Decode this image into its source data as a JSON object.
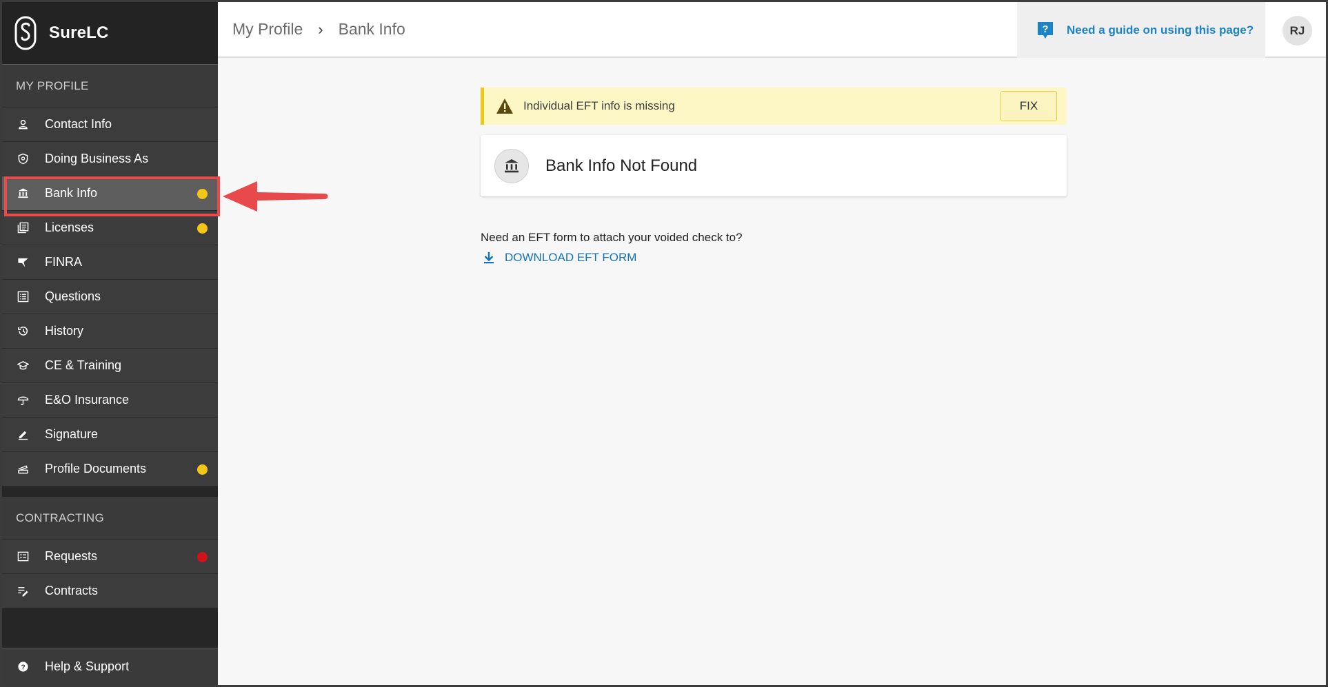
{
  "brand": {
    "name": "SureLC"
  },
  "breadcrumb": {
    "parent": "My Profile",
    "separator": "›",
    "current": "Bank Info"
  },
  "header": {
    "guide_label": "Need a guide on using this page?",
    "avatar_initials": "RJ"
  },
  "sidebar": {
    "profile_header": "MY PROFILE",
    "profile_items": [
      {
        "label": "Contact Info",
        "icon": "person-icon"
      },
      {
        "label": "Doing Business As",
        "icon": "badge-icon"
      },
      {
        "label": "Bank Info",
        "icon": "bank-icon",
        "active": true,
        "status": "warning"
      },
      {
        "label": "Licenses",
        "icon": "licenses-icon",
        "status": "warning"
      },
      {
        "label": "FINRA",
        "icon": "finra-icon"
      },
      {
        "label": "Questions",
        "icon": "list-icon"
      },
      {
        "label": "History",
        "icon": "history-icon"
      },
      {
        "label": "CE & Training",
        "icon": "graduation-cap-icon"
      },
      {
        "label": "E&O Insurance",
        "icon": "umbrella-icon"
      },
      {
        "label": "Signature",
        "icon": "pen-icon"
      },
      {
        "label": "Profile Documents",
        "icon": "scanner-icon",
        "status": "warning"
      }
    ],
    "contracting_header": "CONTRACTING",
    "contracting_items": [
      {
        "label": "Requests",
        "icon": "requests-icon",
        "status": "error"
      },
      {
        "label": "Contracts",
        "icon": "contract-edit-icon"
      }
    ],
    "help_label": "Help & Support"
  },
  "alert": {
    "message": "Individual EFT info is missing",
    "fix_label": "FIX"
  },
  "card": {
    "title": "Bank Info Not Found"
  },
  "eft": {
    "question": "Need an EFT form to attach your voided check to?",
    "download_label": "DOWNLOAD EFT FORM"
  },
  "colors": {
    "warning_dot": "#f5c518",
    "error_dot": "#d0121b",
    "link": "#1673b8",
    "annotation_red": "#e8494a"
  }
}
